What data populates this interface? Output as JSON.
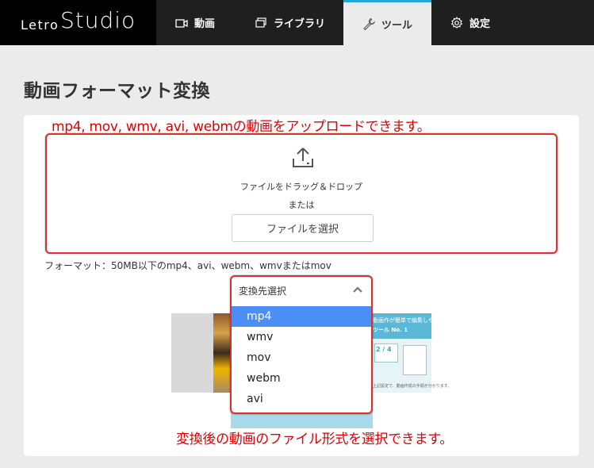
{
  "header": {
    "logo_text_1": "Letro",
    "logo_text_2": "Studio",
    "nav": [
      {
        "label": "動画",
        "icon": "video-icon"
      },
      {
        "label": "ライブラリ",
        "icon": "library-icon"
      },
      {
        "label": "ツール",
        "icon": "wrench-icon",
        "active": true
      },
      {
        "label": "設定",
        "icon": "gear-icon"
      }
    ]
  },
  "page": {
    "title": "動画フォーマット変換"
  },
  "annotations": {
    "top": "mp4, mov, wmv, avi, webmの動画をアップロードできます。",
    "bottom": "変換後の動画のファイル形式を選択できます。"
  },
  "upload": {
    "icon": "upload-icon",
    "drop_text": "ファイルをドラッグ＆ドロップ",
    "or_text": "または",
    "button_label": "ファイルを選択",
    "format_note": "フォーマット：50MB以下のmp4、avi、webm、wmvまたはmov"
  },
  "format_select": {
    "placeholder": "変換先選択",
    "options": [
      "mp4",
      "wmv",
      "mov",
      "webm",
      "avi"
    ],
    "highlighted": "mp4"
  },
  "preview": {
    "thumb_text_1": "動画作が簡単で編集しやすい",
    "thumb_text_2": "ツール No. 1",
    "thumb_text_3": "2 / 4",
    "thumb_text_4": "上記設定で、動画作成の手順が分かります。"
  },
  "colors": {
    "accent": "#20a8d8",
    "annotation": "#e00000",
    "selected_option": "#4c8ef7"
  }
}
